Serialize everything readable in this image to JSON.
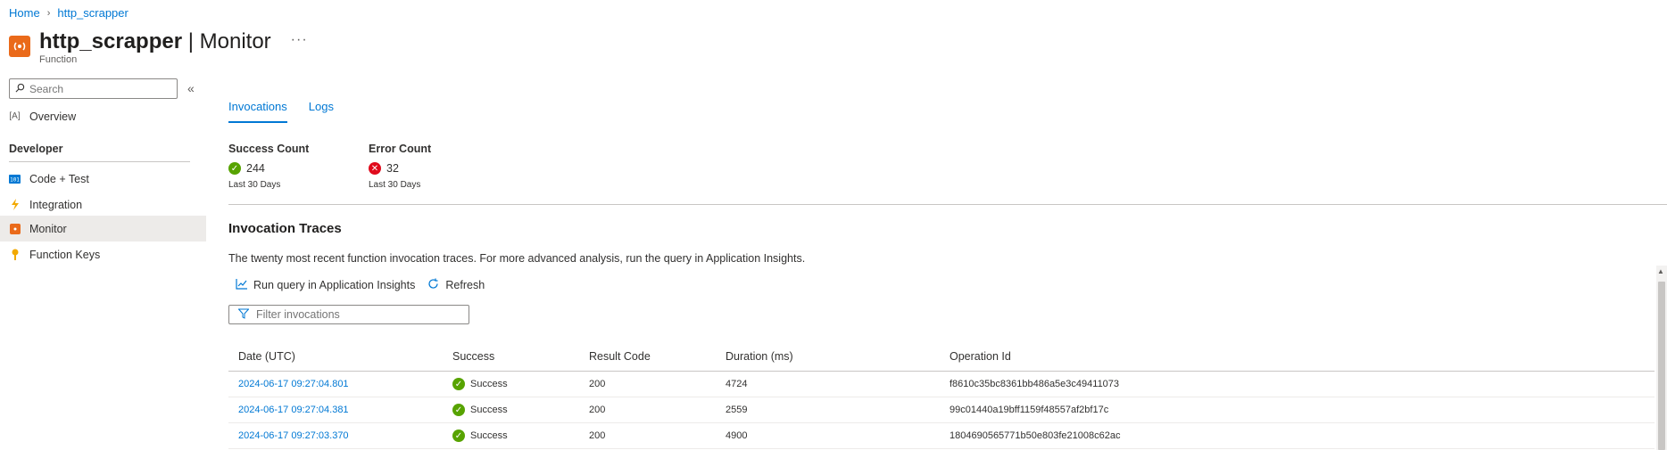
{
  "breadcrumb": {
    "home": "Home",
    "separator": "›",
    "current": "http_scrapper"
  },
  "header": {
    "title_name": "http_scrapper",
    "title_sep": " | ",
    "title_page": "Monitor",
    "subtitle": "Function",
    "more": "···",
    "icon": "function-icon"
  },
  "sidebar": {
    "search_placeholder": "Search",
    "collapse": "«",
    "overview": {
      "label": "Overview",
      "icon": "overview-icon"
    },
    "section_label": "Developer",
    "items": [
      {
        "label": "Code + Test",
        "icon": "code-icon"
      },
      {
        "label": "Integration",
        "icon": "lightning-icon"
      },
      {
        "label": "Monitor",
        "icon": "monitor-icon",
        "active": true
      },
      {
        "label": "Function Keys",
        "icon": "key-icon"
      }
    ]
  },
  "tabs": [
    {
      "label": "Invocations",
      "active": true
    },
    {
      "label": "Logs",
      "active": false
    }
  ],
  "metrics": {
    "success": {
      "label": "Success Count",
      "value": "244",
      "sub": "Last 30 Days"
    },
    "error": {
      "label": "Error Count",
      "value": "32",
      "sub": "Last 30 Days"
    }
  },
  "traces": {
    "title": "Invocation Traces",
    "description": "The twenty most recent function invocation traces. For more advanced analysis, run the query in Application Insights.",
    "run_query": "Run query in Application Insights",
    "refresh": "Refresh",
    "filter_placeholder": "Filter invocations"
  },
  "table": {
    "headers": [
      "Date (UTC)",
      "Success",
      "Result Code",
      "Duration (ms)",
      "Operation Id"
    ],
    "rows": [
      {
        "date": "2024-06-17 09:27:04.801",
        "success": "Success",
        "code": "200",
        "duration": "4724",
        "op": "f8610c35bc8361bb486a5e3c49411073"
      },
      {
        "date": "2024-06-17 09:27:04.381",
        "success": "Success",
        "code": "200",
        "duration": "2559",
        "op": "99c01440a19bff1159f48557af2bf17c"
      },
      {
        "date": "2024-06-17 09:27:03.370",
        "success": "Success",
        "code": "200",
        "duration": "4900",
        "op": "1804690565771b50e803fe21008c62ac"
      }
    ]
  },
  "colors": {
    "accent": "#0078d4",
    "success": "#57a300",
    "error": "#e00b1c",
    "brand": "#ea6a1a"
  }
}
